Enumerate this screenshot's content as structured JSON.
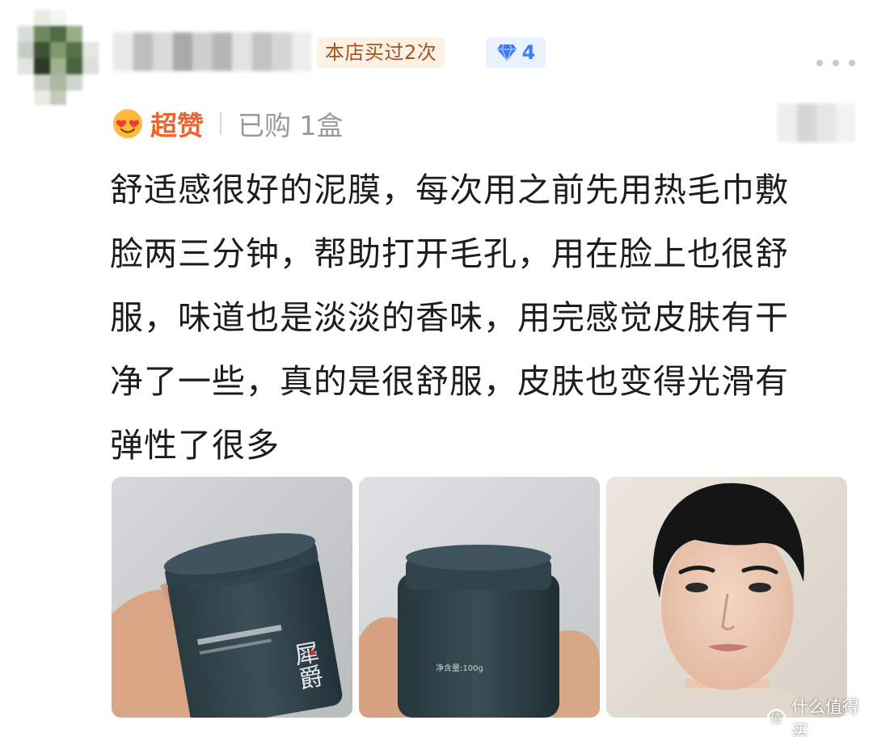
{
  "header": {
    "badge_bought": "本店买过2次",
    "diamond_count": "4"
  },
  "rating": {
    "label": "超赞",
    "purchase_info": "已购 1盒"
  },
  "review": {
    "lines": [
      "舒适感很好的泥膜，每次用之前先用热毛巾敷",
      "脸两三分钟，帮助打开毛孔，用在脸上也很舒",
      "服，味道也是淡淡的香味，用完感觉皮肤有干",
      "净了一些，真的是很舒服，皮肤也变得光滑有",
      "弹性了很多"
    ]
  },
  "photos": {
    "jar_brand": "犀爵",
    "jar_weight": "净含量:100g"
  },
  "watermark": {
    "text": "什么值得买"
  },
  "colors": {
    "rating_orange": "#f0642b",
    "badge_bg": "#fdf1e6",
    "badge_text": "#a0541f",
    "diamond_blue": "#3e7bf2"
  },
  "icons": [
    "heart-eyes-emoji-icon",
    "diamond-icon",
    "more-dots-icon",
    "watermark-logo-icon"
  ]
}
